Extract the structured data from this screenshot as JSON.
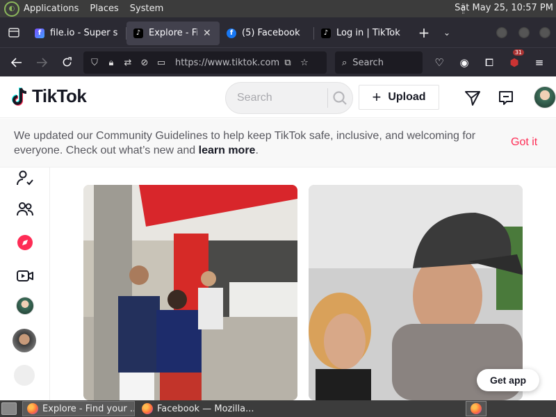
{
  "system_panel": {
    "menus": [
      "Applications",
      "Places",
      "System"
    ],
    "clock": "Sat May 25, 10:57 PM"
  },
  "tabs": [
    {
      "title": "file.io - Super s",
      "favicon": "fileio-icon",
      "active": false
    },
    {
      "title": "Explore - Find",
      "favicon": "tiktok-icon",
      "active": true
    },
    {
      "title": "(5) Facebook",
      "favicon": "facebook-icon",
      "active": false
    },
    {
      "title": "Log in | TikTok",
      "favicon": "tiktok-icon",
      "active": false
    }
  ],
  "navbar": {
    "url": "https://www.tiktok.com",
    "search_placeholder": "Search",
    "extension_badge": "31"
  },
  "tiktok": {
    "logo_text": "TikTok",
    "search_placeholder": "Search",
    "upload_label": "Upload",
    "notice_text_prefix": "We updated our Community Guidelines to help keep TikTok safe, inclusive, and welcoming for everyone. Check out what’s new and ",
    "notice_link": "learn more",
    "notice_suffix": ".",
    "got_it": "Got it",
    "get_app": "Get app"
  },
  "taskbar": {
    "items": [
      {
        "label": "Explore - Find your ...",
        "active": true
      },
      {
        "label": "Facebook — Mozilla...",
        "active": false
      }
    ]
  },
  "colors": {
    "tiktok_red": "#fe2c55",
    "browser_chrome": "#2b2a33",
    "panel": "#3c3c3c"
  }
}
